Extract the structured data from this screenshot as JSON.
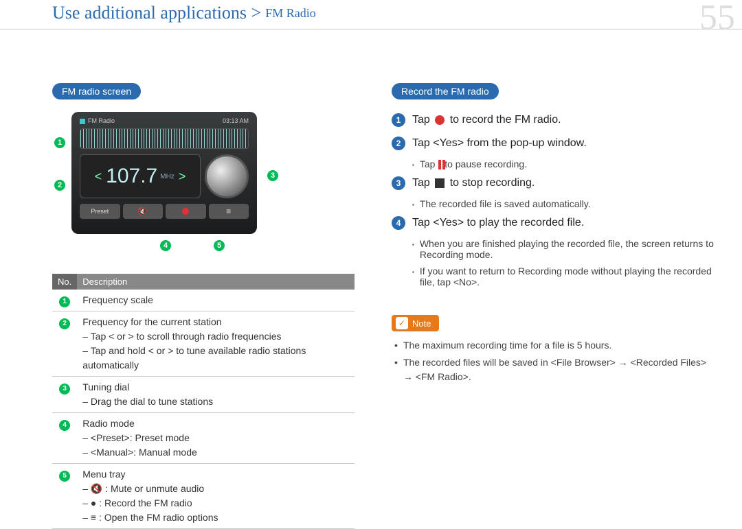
{
  "header": {
    "breadcrumb_main": "Use additional applications >",
    "breadcrumb_sub": "FM Radio",
    "page_number": "55"
  },
  "left": {
    "pill": "FM radio screen",
    "radio": {
      "title": "FM Radio",
      "time": "03:13 AM",
      "freq": "107.7",
      "unit": "MHz",
      "preset_label": "Preset"
    },
    "table": {
      "head_no": "No.",
      "head_desc": "Description",
      "rows": [
        {
          "n": "1",
          "lines": [
            "Frequency scale"
          ]
        },
        {
          "n": "2",
          "lines": [
            "Frequency for the current station",
            "– Tap < or > to scroll through radio frequencies",
            "– Tap and hold < or > to tune available radio stations automatically"
          ]
        },
        {
          "n": "3",
          "lines": [
            "Tuning dial",
            "– Drag the dial to tune stations"
          ]
        },
        {
          "n": "4",
          "lines": [
            "Radio mode",
            "– <Preset>: Preset mode",
            "– <Manual>: Manual mode"
          ]
        },
        {
          "n": "5",
          "lines": [
            "Menu tray",
            "– 🔇 : Mute or unmute audio",
            "– ● : Record the FM radio",
            "– ≡ : Open the FM radio options"
          ]
        }
      ]
    }
  },
  "right": {
    "pill": "Record the FM radio",
    "steps": {
      "s1_pre": "Tap ",
      "s1_post": " to record the FM radio.",
      "s2": "Tap <Yes> from the pop-up window.",
      "s2_sub_pre": "Tap ",
      "s2_sub_post": " to pause recording.",
      "s3_pre": "Tap ",
      "s3_post": " to stop recording.",
      "s3_sub": "The recorded file is saved automatically.",
      "s4": "Tap <Yes> to play the recorded file.",
      "s4_sub1": "When you are finished playing the recorded file, the screen returns to Recording mode.",
      "s4_sub2": "If you want to return to Recording mode without playing the recorded file, tap <No>."
    },
    "note": {
      "label": "Note",
      "items": [
        "The maximum recording time for a file is 5 hours.",
        "The recorded files will be saved in <File Browser> → <Recorded Files> → <FM Radio>."
      ]
    }
  }
}
